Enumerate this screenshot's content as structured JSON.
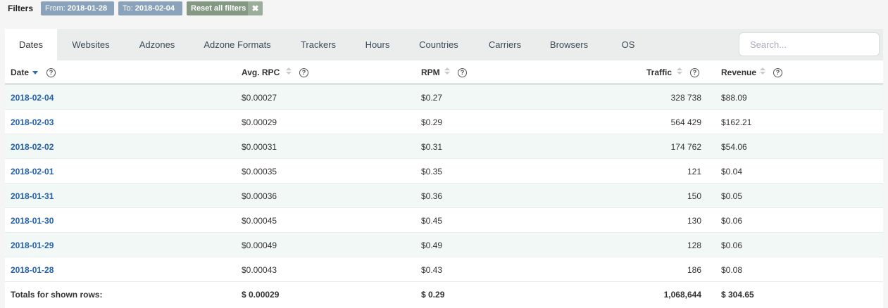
{
  "filters": {
    "label": "Filters",
    "from_prefix": "From:",
    "from_value": "2018-01-28",
    "to_prefix": "To:",
    "to_value": "2018-02-04",
    "reset_label": "Reset all filters",
    "reset_icon": "close-icon"
  },
  "tabs": [
    "Dates",
    "Websites",
    "Adzones",
    "Adzone Formats",
    "Trackers",
    "Hours",
    "Countries",
    "Carriers",
    "Browsers",
    "OS"
  ],
  "active_tab": "Dates",
  "search": {
    "placeholder": "Search..."
  },
  "columns": [
    "Date",
    "Avg. RPC",
    "RPM",
    "Traffic",
    "Revenue"
  ],
  "sort": {
    "column": "Date",
    "direction": "desc"
  },
  "rows": [
    {
      "date": "2018-02-04",
      "rpc": "$0.00027",
      "rpm": "$0.27",
      "traffic": "328 738",
      "revenue": "$88.09"
    },
    {
      "date": "2018-02-03",
      "rpc": "$0.00029",
      "rpm": "$0.29",
      "traffic": "564 429",
      "revenue": "$162.21"
    },
    {
      "date": "2018-02-02",
      "rpc": "$0.00031",
      "rpm": "$0.31",
      "traffic": "174 762",
      "revenue": "$54.06"
    },
    {
      "date": "2018-02-01",
      "rpc": "$0.00035",
      "rpm": "$0.35",
      "traffic": "121",
      "revenue": "$0.04"
    },
    {
      "date": "2018-01-31",
      "rpc": "$0.00036",
      "rpm": "$0.36",
      "traffic": "150",
      "revenue": "$0.05"
    },
    {
      "date": "2018-01-30",
      "rpc": "$0.00045",
      "rpm": "$0.45",
      "traffic": "130",
      "revenue": "$0.06"
    },
    {
      "date": "2018-01-29",
      "rpc": "$0.00049",
      "rpm": "$0.49",
      "traffic": "128",
      "revenue": "$0.06"
    },
    {
      "date": "2018-01-28",
      "rpc": "$0.00043",
      "rpm": "$0.43",
      "traffic": "186",
      "revenue": "$0.08"
    }
  ],
  "totals": {
    "label": "Totals for shown rows:",
    "rpc": "$ 0.00029",
    "rpm": "$ 0.29",
    "traffic": "1,068,644",
    "revenue": "$ 304.65"
  },
  "colors": {
    "link": "#2461ad",
    "chip_filter": "#8aa3ba",
    "chip_reset": "#849884",
    "row_alt": "#f2f8f6"
  }
}
